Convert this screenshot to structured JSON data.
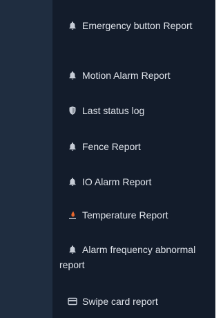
{
  "menu": {
    "items": [
      {
        "label": "Emergency button Report",
        "icon": "bell-icon"
      },
      {
        "label": "Motion Alarm Report",
        "icon": "bell-icon"
      },
      {
        "label": "Last status log",
        "icon": "shield-icon"
      },
      {
        "label": "Fence Report",
        "icon": "bell-icon"
      },
      {
        "label": "IO Alarm Report",
        "icon": "bell-icon"
      },
      {
        "label": "Temperature Report",
        "icon": "thermometer-icon"
      },
      {
        "label": "Alarm frequency abnormal report",
        "icon": "bell-icon"
      },
      {
        "label": "Swipe card report",
        "icon": "card-icon"
      }
    ]
  },
  "colors": {
    "rail": "#1f2d40",
    "panel": "#131c2b",
    "text": "#dfe3ea",
    "icon": "#c6ccd6",
    "temperature_accent": "#e8662c"
  }
}
